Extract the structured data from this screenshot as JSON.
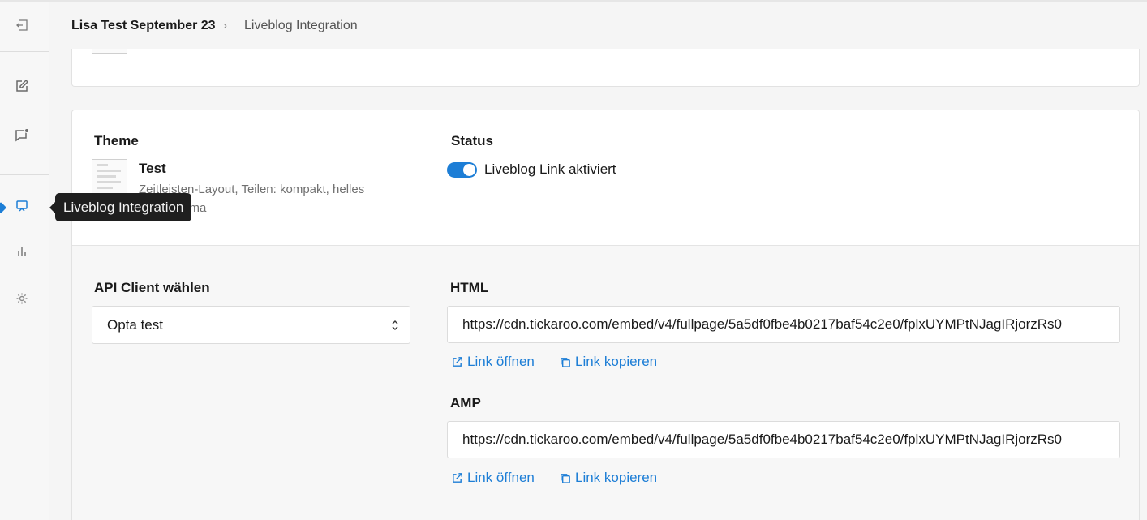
{
  "colors": {
    "accent": "#1d7ed6",
    "tooltip_bg": "#1f1f1f",
    "page_bg": "#f5f5f5"
  },
  "sidebar": {
    "items": [
      {
        "name": "collapse",
        "icon": "collapse-icon"
      },
      {
        "name": "edit",
        "icon": "edit-icon"
      },
      {
        "name": "comments",
        "icon": "comment-icon"
      },
      {
        "name": "liveblog-integration",
        "icon": "monitor-icon",
        "active": true
      },
      {
        "name": "statistics",
        "icon": "bar-chart-icon"
      },
      {
        "name": "settings",
        "icon": "gear-icon"
      }
    ],
    "tooltip": "Liveblog Integration"
  },
  "breadcrumb": {
    "parent": "Lisa Test September 23",
    "separator": "›",
    "current": "Liveblog Integration"
  },
  "theme": {
    "label": "Theme",
    "name": "Test",
    "description": "Zeitleisten-Layout, Teilen: kompakt, helles Farbschema"
  },
  "status": {
    "label": "Status",
    "toggle_on": true,
    "toggle_label": "Liveblog Link aktiviert"
  },
  "api_client": {
    "label": "API Client wählen",
    "selected": "Opta test"
  },
  "html_embed": {
    "label": "HTML",
    "url": "https://cdn.tickaroo.com/embed/v4/fullpage/5a5df0fbe4b0217baf54c2e0/fplxUYMPtNJagIRjorzRs0",
    "open_link": "Link öffnen",
    "copy_link": "Link kopieren"
  },
  "amp_embed": {
    "label": "AMP",
    "url": "https://cdn.tickaroo.com/embed/v4/fullpage/5a5df0fbe4b0217baf54c2e0/fplxUYMPtNJagIRjorzRs0",
    "open_link": "Link öffnen",
    "copy_link": "Link kopieren"
  }
}
